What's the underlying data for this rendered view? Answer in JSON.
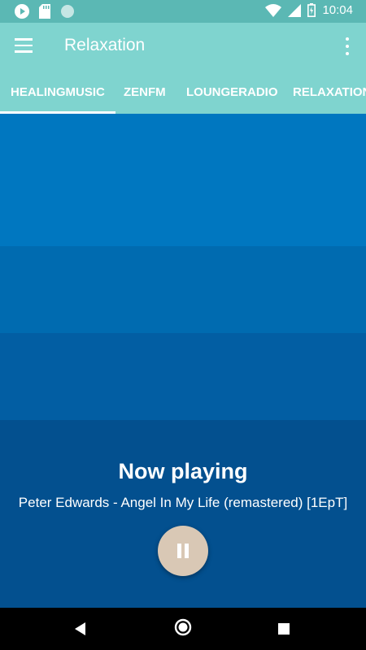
{
  "status_bar": {
    "time": "10:04",
    "left_icons": [
      "play-notification-icon",
      "sd-card-icon",
      "circle-notification-icon"
    ],
    "right_icons": [
      "wifi-icon",
      "signal-icon",
      "battery-icon"
    ]
  },
  "app_bar": {
    "title": "Relaxation",
    "menu_icon": "hamburger-menu-icon",
    "overflow_icon": "more-vertical-icon"
  },
  "tabs": [
    {
      "label": "HEALINGMUSIC",
      "active": true
    },
    {
      "label": "ZENFM",
      "active": false
    },
    {
      "label": "LOUNGERADIO",
      "active": false
    },
    {
      "label": "RELAXATION",
      "active": false
    }
  ],
  "colors": {
    "teal": "#7fd4cf",
    "status_teal": "#5bb8b4",
    "band_1": "#0077c0",
    "band_2": "#006bb0",
    "band_3": "#025ea3",
    "now_playing_bg": "#03508f",
    "pause_button": "#d9c8b5"
  },
  "now_playing": {
    "heading": "Now playing",
    "track": "Peter Edwards - Angel In My Life (remastered) [1EpT]",
    "button_icon": "pause-icon"
  },
  "nav_bar": {
    "icons": [
      "back-triangle-icon",
      "home-circle-icon",
      "recents-square-icon"
    ]
  }
}
